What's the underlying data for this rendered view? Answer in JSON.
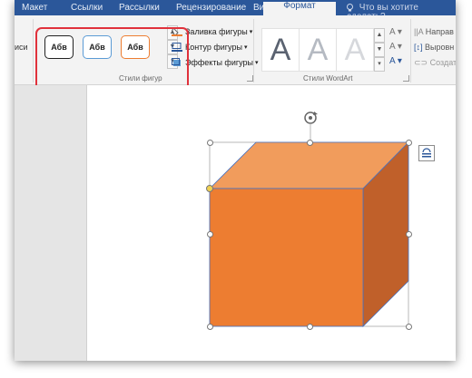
{
  "tabs": {
    "items": [
      "Макет",
      "Ссылки",
      "Рассылки",
      "Рецензирование",
      "Вид",
      "Формат"
    ],
    "tell_me": "Что вы хотите сделать?"
  },
  "ribbon": {
    "left_cut_label": "иси",
    "shape_styles": {
      "buttons": [
        {
          "label": "Абв",
          "border_color": "#222222"
        },
        {
          "label": "Абв",
          "border_color": "#5b9bd5"
        },
        {
          "label": "Абв",
          "border_color": "#ed7d31"
        }
      ],
      "group_label": "Стили фигур"
    },
    "commands": [
      {
        "label": "Заливка фигуры",
        "arrow": "▾",
        "icon": "fill-icon"
      },
      {
        "label": "Контур фигуры",
        "arrow": "▾",
        "icon": "outline-icon"
      },
      {
        "label": "Эффекты фигуры",
        "arrow": "▾",
        "icon": "effects-icon"
      }
    ],
    "wordart": {
      "samples": [
        "A",
        "A",
        "A"
      ],
      "group_label": "Стили WordArt",
      "side_buttons": [
        "A ▾",
        "A ▾",
        "A ▾"
      ]
    },
    "text_group": {
      "items": [
        "Направ",
        "Выровн",
        "Создат"
      ]
    }
  },
  "colors": {
    "accent_blue": "#2b579a",
    "shape_front": "#ed7d31",
    "shape_top": "#f19c5c",
    "shape_side": "#c0602a",
    "highlight_red": "#e0313b"
  }
}
